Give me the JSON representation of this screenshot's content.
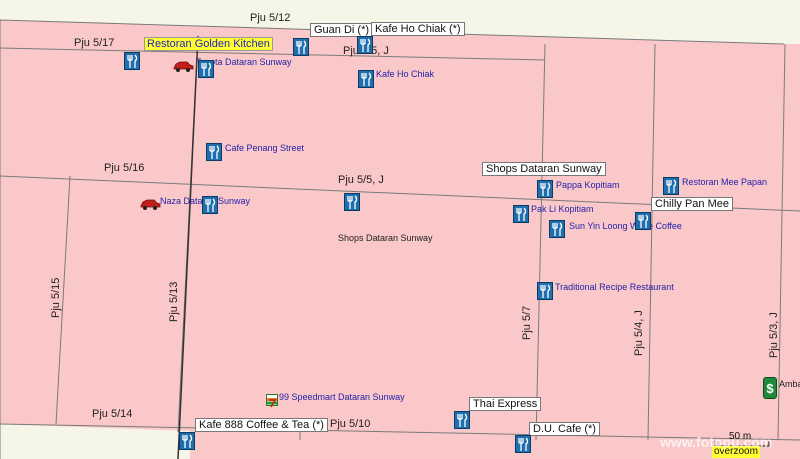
{
  "roads": {
    "pju_5_12": "Pju 5/12",
    "pju_5_17": "Pju 5/17",
    "pju_5_j_top": "Pju 5/5, J",
    "pju_5_16": "Pju 5/16",
    "pju_5_5_j": "Pju 5/5, J",
    "pju_5_15": "Pju 5/15",
    "pju_5_13": "Pju 5/13",
    "pju_5_7": "Pju 5/7",
    "pju_5_4_j": "Pju 5/4, J",
    "pju_5_3_j": "Pju 5/3, J",
    "pju_5_14": "Pju 5/14",
    "pju_5_10": "Pju 5/10"
  },
  "callouts": {
    "restoran_golden_kitchen": "Restoran Golden Kitchen",
    "guan_di": "Guan Di (*)",
    "kafe_ho_chiak_star": "Kafe Ho Chiak (*)",
    "shops_dataran_sunway_box": "Shops Dataran Sunway",
    "chilly_pan_mee": "Chilly Pan Mee",
    "thai_express": "Thai Express",
    "du_cafe": "D.U. Cafe (*)",
    "kafe_888": "Kafe 888 Coffee & Tea (*)"
  },
  "pois": {
    "toyota": "Toyota Dataran Sunway",
    "kafe_ho_chiak": "Kafe Ho Chiak",
    "cafe_penang_street": "Cafe Penang Street",
    "naza": "Naza Dataran Sunway",
    "shops_dataran_sunway": "Shops Dataran Sunway",
    "pappa_kopitiam": "Pappa Kopitiam",
    "pak_li_kopitiam": "Pak Li Kopitiam",
    "sun_yin_loong": "Sun Yin Loong White Coffee",
    "restoran_mee_papan": "Restoran Mee Papan",
    "traditional_recipe": "Traditional Recipe Restaurant",
    "speedmart": "99 Speedmart Dataran Sunway",
    "amba": "Amba"
  },
  "scale": {
    "label": "50 m",
    "overzoom": "overzoom"
  },
  "watermark": "www.fotopu.com",
  "colors": {
    "area_fill": "#fac8c8",
    "background": "#f5f5e8",
    "road_line": "#777777",
    "poi_text": "#2222aa",
    "icon_fill": "#1f6fae"
  }
}
